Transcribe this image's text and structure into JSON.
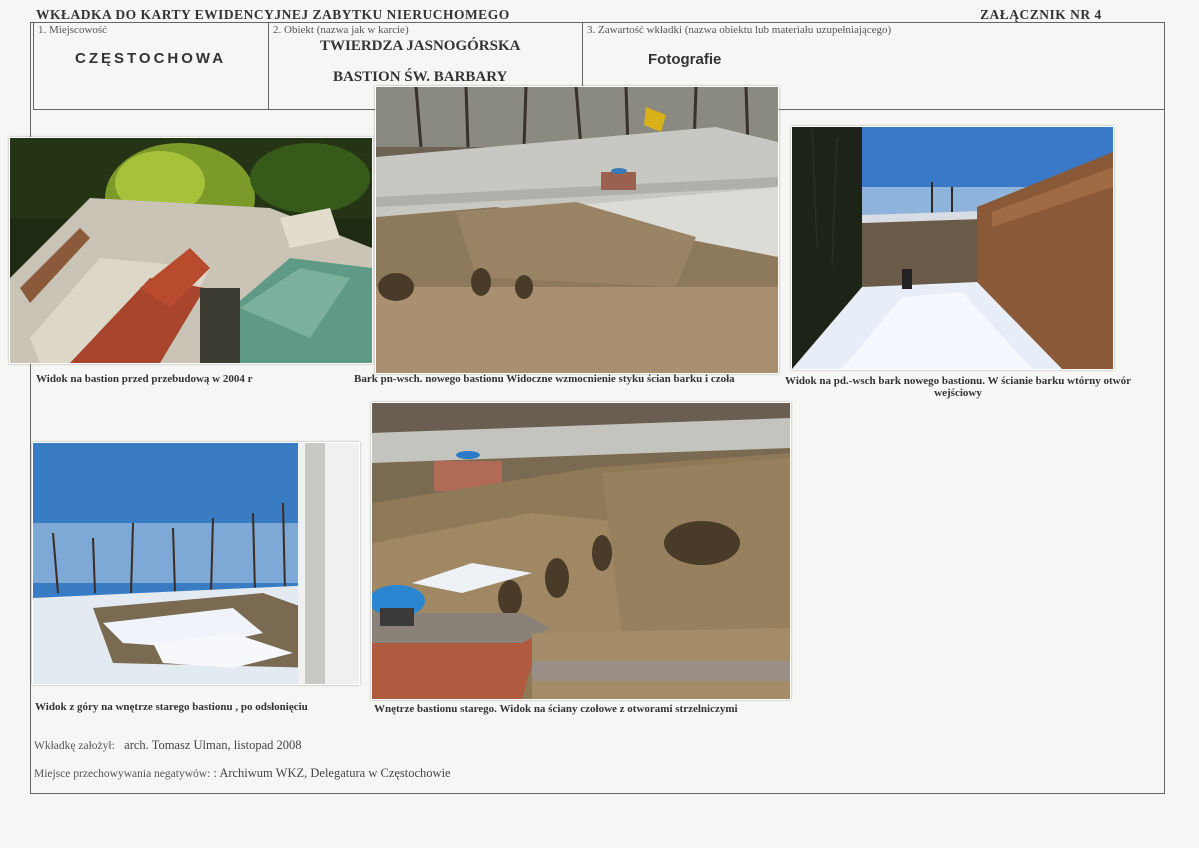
{
  "header": {
    "title": "WKŁADKA DO KARTY EWIDENCYJNEJ ZABYTKU NIERUCHOMEGO",
    "annex": "ZAŁĄCZNIK NR 4"
  },
  "fields": {
    "locality_label": "1. Miejscowość",
    "locality_value": "CZĘSTOCHOWA",
    "object_label": "2. Obiekt (nazwa jak w karcie)",
    "object_line1": "TWIERDZA JASNOGÓRSKA",
    "object_line2": "BASTION ŚW. BARBARY",
    "content_label": "3. Zawartość wkładki (nazwa obiektu lub materiału uzupełniającego)",
    "content_value": "Fotografie"
  },
  "photos": [
    {
      "caption": "Widok na bastion przed przebudową w 2004 r",
      "subject": "aerial-bastion"
    },
    {
      "caption": "Bark pn-wsch. nowego bastionu Widoczne  wzmocnienie styku ścian barku i czoła",
      "subject": "stone-ruins"
    },
    {
      "caption_line1": "Widok na pd.-wsch bark nowego bastionu. W ścianie barku  wtórny otwór",
      "caption_line2": "wejściowy",
      "subject": "snow-wall"
    },
    {
      "caption": "Widok  z góry na wnętrze starego bastionu ,  po odsłonięciu",
      "subject": "snow-excavation"
    },
    {
      "caption": "Wnętrze  bastionu starego. Widok na ściany czołowe z otworami strzelniczymi",
      "subject": "embrasures"
    }
  ],
  "footer": {
    "author_label": "Wkładkę założył:",
    "author_value": "arch. Tomasz Ulman, listopad 2008",
    "storage_label": "Miejsce przechowywania negatywów:",
    "storage_value": ": Archiwum WKZ, Delegatura w Częstochowie"
  }
}
